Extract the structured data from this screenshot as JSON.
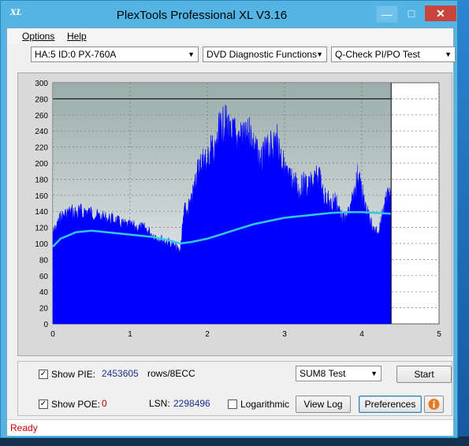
{
  "window": {
    "title": "PlexTools Professional XL V3.16",
    "app_icon_text": "XL"
  },
  "menu": {
    "options": "Options",
    "help": "Help"
  },
  "toolbar": {
    "drive": "HA:5 ID:0  PX-760A",
    "function": "DVD Diagnostic Functions",
    "test": "Q-Check PI/PO Test"
  },
  "controls": {
    "show_pie_label": "Show PIE:",
    "show_pie_value": "2453605",
    "show_pie_unit": "rows/8ECC",
    "show_poe_label": "Show POE:",
    "show_poe_value": "0",
    "lsn_label": "LSN:",
    "lsn_value": "2298496",
    "logarithmic_label": "Logarithmic",
    "sum8_select": "SUM8 Test",
    "start_button": "Start",
    "view_log_button": "View Log",
    "preferences_button": "Preferences",
    "show_pie_checked": true,
    "show_poe_checked": true,
    "logarithmic_checked": false
  },
  "status": {
    "text": "Ready"
  },
  "colors": {
    "accent": "#54b5e4",
    "pie_fill": "#0000ff",
    "avg_line": "#32c8e6",
    "status_red": "#d00000"
  },
  "chart_data": {
    "type": "area",
    "xlim": [
      0,
      5
    ],
    "ylim": [
      0,
      300
    ],
    "x_ticks": [
      "0",
      "1",
      "2",
      "3",
      "4",
      "5"
    ],
    "y_ticks": [
      "0",
      "20",
      "40",
      "60",
      "80",
      "100",
      "120",
      "140",
      "160",
      "180",
      "200",
      "220",
      "240",
      "260",
      "280",
      "300"
    ],
    "reference_line_y": 280,
    "end_marker_x": 4.38,
    "grid": true,
    "series": [
      {
        "kind": "pie",
        "x": [
          0.0,
          0.05,
          0.1,
          0.2,
          0.3,
          0.4,
          0.5,
          0.6,
          0.7,
          0.8,
          0.9,
          1.0,
          1.1,
          1.2,
          1.3,
          1.4,
          1.5,
          1.6,
          1.65,
          1.7,
          1.8,
          1.85,
          1.9,
          1.95,
          2.0,
          2.05,
          2.1,
          2.15,
          2.2,
          2.25,
          2.3,
          2.35,
          2.4,
          2.45,
          2.5,
          2.55,
          2.6,
          2.65,
          2.7,
          2.75,
          2.8,
          2.85,
          2.9,
          2.95,
          3.0,
          3.05,
          3.1,
          3.15,
          3.2,
          3.25,
          3.3,
          3.35,
          3.4,
          3.45,
          3.5,
          3.55,
          3.6,
          3.65,
          3.7,
          3.75,
          3.8,
          3.85,
          3.9,
          3.95,
          4.0,
          4.05,
          4.1,
          4.15,
          4.2,
          4.25,
          4.3,
          4.35,
          4.38
        ],
        "values": [
          120,
          128,
          142,
          148,
          152,
          150,
          148,
          142,
          140,
          138,
          132,
          130,
          128,
          126,
          118,
          112,
          108,
          100,
          96,
          150,
          165,
          200,
          215,
          225,
          220,
          240,
          230,
          262,
          270,
          275,
          255,
          262,
          250,
          258,
          250,
          262,
          245,
          230,
          220,
          235,
          238,
          245,
          250,
          232,
          210,
          198,
          195,
          190,
          182,
          192,
          186,
          190,
          196,
          200,
          175,
          170,
          160,
          170,
          155,
          140,
          140,
          155,
          175,
          205,
          180,
          155,
          140,
          125,
          120,
          135,
          160,
          175,
          180
        ]
      },
      {
        "kind": "pie_average",
        "x": [
          0.0,
          0.1,
          0.3,
          0.5,
          0.7,
          0.9,
          1.1,
          1.3,
          1.5,
          1.65,
          1.8,
          2.0,
          2.2,
          2.4,
          2.6,
          2.8,
          3.0,
          3.2,
          3.4,
          3.6,
          3.8,
          4.0,
          4.2,
          4.38
        ],
        "values": [
          96,
          106,
          114,
          116,
          114,
          112,
          110,
          108,
          104,
          100,
          102,
          106,
          112,
          118,
          124,
          128,
          132,
          134,
          136,
          138,
          139,
          139,
          138,
          137
        ]
      }
    ]
  }
}
